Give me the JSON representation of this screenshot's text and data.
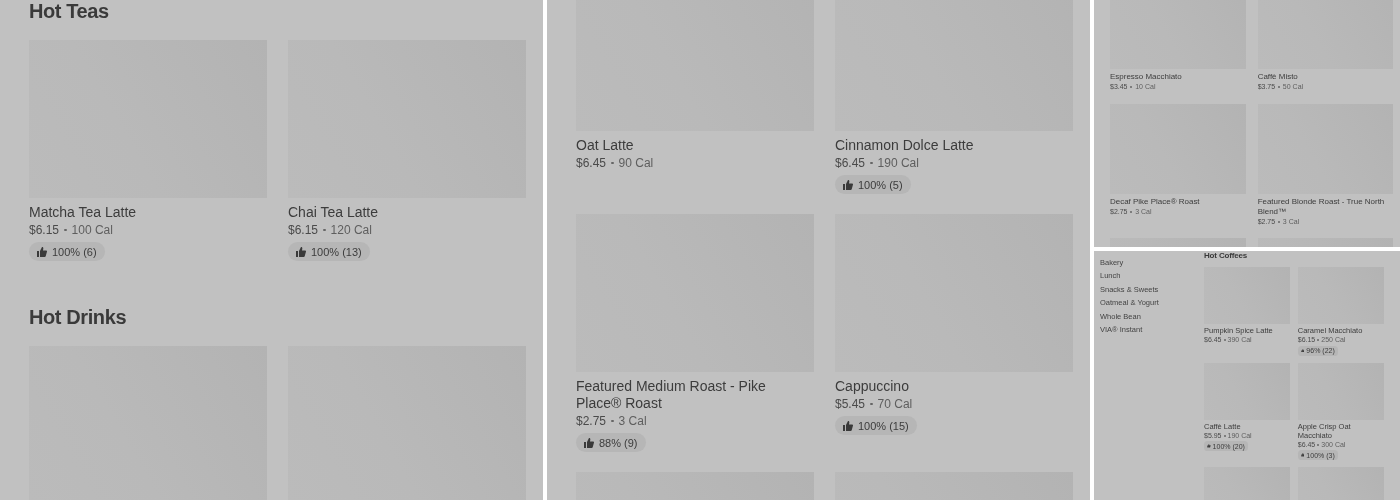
{
  "panels": [
    {
      "kind": "menu",
      "sections": [
        {
          "title": "Hot Teas",
          "items": [
            {
              "kind": "product",
              "name": "Matcha Tea Latte",
              "price": "$6.15",
              "calories": "100 Cal",
              "rating": "100% (6)"
            },
            {
              "kind": "product",
              "name": "Chai Tea Latte",
              "price": "$6.15",
              "calories": "120 Cal",
              "rating": "100% (13)"
            }
          ]
        },
        {
          "title": "Hot Drinks",
          "items": [
            {
              "kind": "image"
            },
            {
              "kind": "image"
            }
          ]
        }
      ]
    },
    {
      "kind": "menu",
      "sections": [
        {
          "items": [
            {
              "kind": "product",
              "name": "Oat Latte",
              "price": "$6.45",
              "calories": "90 Cal"
            },
            {
              "kind": "product",
              "name": "Cinnamon Dolce Latte",
              "price": "$6.45",
              "calories": "190 Cal",
              "rating": "100% (5)"
            },
            {
              "kind": "product",
              "name": "Featured Medium Roast - Pike Place® Roast",
              "price": "$2.75",
              "calories": "3 Cal",
              "rating": "88% (9)"
            },
            {
              "kind": "product",
              "name": "Cappuccino",
              "price": "$5.45",
              "calories": "70 Cal",
              "rating": "100% (15)"
            },
            {
              "kind": "image"
            },
            {
              "kind": "image"
            }
          ]
        }
      ]
    },
    {
      "kind": "menu",
      "sections": [
        {
          "items": [
            {
              "kind": "product",
              "name": "Espresso Macchiato",
              "price": "$3.45",
              "calories": "10 Cal"
            },
            {
              "kind": "product",
              "name": "Caffè Misto",
              "price": "$3.75",
              "calories": "50 Cal"
            },
            {
              "kind": "product",
              "name": "Decaf Pike Place® Roast",
              "price": "$2.75",
              "calories": "3 Cal"
            },
            {
              "kind": "product",
              "name": "Featured Blonde Roast - True North Blend™",
              "price": "$2.75",
              "calories": "3 Cal"
            },
            {
              "kind": "image"
            },
            {
              "kind": "image"
            }
          ]
        }
      ]
    },
    {
      "kind": "menu_with_sidebar",
      "sidebar": {
        "items": [
          "Bakery",
          "Lunch",
          "Snacks & Sweets",
          "Oatmeal & Yogurt",
          "Whole Bean",
          "VIA® Instant"
        ]
      },
      "sections": [
        {
          "title": "Hot Coffees",
          "items": [
            {
              "kind": "product",
              "name": "Pumpkin Spice Latte",
              "price": "$6.45",
              "calories": "390 Cal"
            },
            {
              "kind": "product",
              "name": "Caramel Macchiato",
              "price": "$6.15",
              "calories": "250 Cal",
              "rating": "96% (22)"
            },
            {
              "kind": "product",
              "name": "Caffè Latte",
              "price": "$5.95",
              "calories": "190 Cal",
              "rating": "100% (20)"
            },
            {
              "kind": "product",
              "name": "Apple Crisp Oat Macchiato",
              "price": "$6.45",
              "calories": "300 Cal",
              "rating": "100% (3)"
            },
            {
              "kind": "image"
            },
            {
              "kind": "image"
            }
          ]
        }
      ]
    }
  ]
}
